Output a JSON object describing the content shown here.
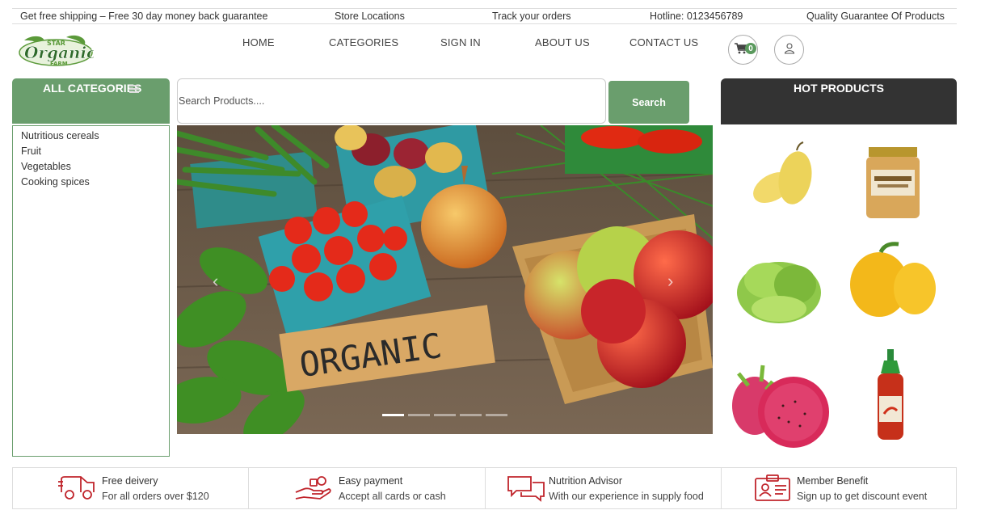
{
  "topbar": {
    "shipping": "Get free shipping – Free 30 day money back guarantee",
    "stores": "Store Locations",
    "track": "Track your orders",
    "hotline": "Hotline: 0123456789",
    "quality": "Quality Guarantee Of Products"
  },
  "logo": {
    "top": "STAR",
    "main": "Organic",
    "sub": "FARM"
  },
  "nav": {
    "home": "HOME",
    "categories": "CATEGORIES",
    "signin": "SIGN IN",
    "about": "ABOUT US",
    "contact": "CONTACT US"
  },
  "cart": {
    "count": "0"
  },
  "categories": {
    "title": "ALL CATEGORIES",
    "items": [
      "Nutritious cereals",
      "Fruit",
      "Vegetables",
      "Cooking spices"
    ]
  },
  "search": {
    "placeholder": "Search Products....",
    "button": "Search"
  },
  "hero": {
    "sign_text": "ORGANIC",
    "active_slide": 1,
    "slides": 5
  },
  "hot_products": {
    "title": "HOT PRODUCTS"
  },
  "features": [
    {
      "title": "Free deivery",
      "subtitle": "For all orders over $120",
      "icon": "truck-icon"
    },
    {
      "title": "Easy payment",
      "subtitle": "Accept all cards or cash",
      "icon": "hand-money-icon"
    },
    {
      "title": "Nutrition Advisor",
      "subtitle": "With our experience in supply food",
      "icon": "chat-bubbles-icon"
    },
    {
      "title": "Member Benefit",
      "subtitle": "Sign up to get discount event",
      "icon": "id-card-icon"
    }
  ],
  "colors": {
    "accent": "#6a9e6d",
    "dark": "#333333",
    "icon_red": "#c0242b"
  }
}
